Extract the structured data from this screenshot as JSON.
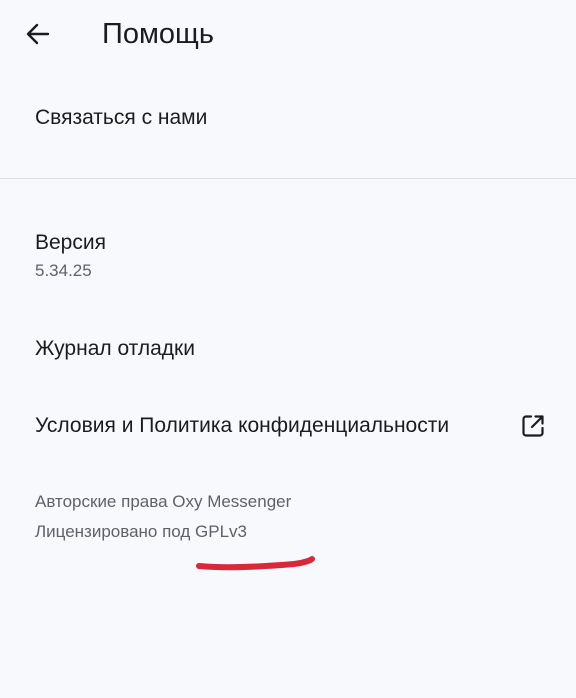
{
  "header": {
    "title": "Помощь",
    "back_icon": "arrow-left-icon"
  },
  "items": {
    "contact": {
      "label": "Связаться с нами"
    },
    "version": {
      "label": "Версия",
      "value": "5.34.25"
    },
    "debug_log": {
      "label": "Журнал отладки"
    },
    "terms": {
      "label": "Условия и Политика конфиденциальности",
      "icon": "external-link-icon"
    }
  },
  "footer": {
    "copyright": "Авторские права Oxy Messenger",
    "license": "Лицензировано под GPLv3"
  },
  "colors": {
    "background": "#f8f9fd",
    "text_primary": "#1b1c20",
    "text_secondary": "#5f6168",
    "divider": "#dedfe4",
    "annotation": "#d8293a"
  }
}
